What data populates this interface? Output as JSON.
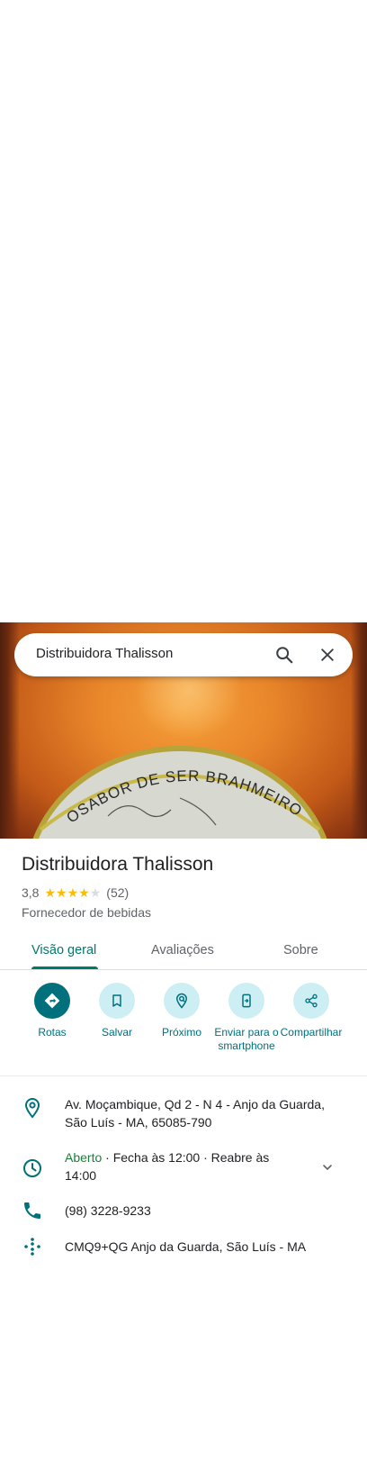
{
  "search": {
    "query": "Distribuidora Thalisson"
  },
  "hero": {
    "label_text": "OSABOR DE SER BRAHMEIRO"
  },
  "place": {
    "name": "Distribuidora Thalisson",
    "rating": "3,8",
    "rating_value": 3.8,
    "review_count": "(52)",
    "category": "Fornecedor de bebidas"
  },
  "tabs": [
    {
      "label": "Visão geral",
      "active": true
    },
    {
      "label": "Avaliações",
      "active": false
    },
    {
      "label": "Sobre",
      "active": false
    }
  ],
  "actions": [
    {
      "label": "Rotas",
      "icon": "directions-icon"
    },
    {
      "label": "Salvar",
      "icon": "bookmark-icon"
    },
    {
      "label": "Próximo",
      "icon": "nearby-icon"
    },
    {
      "label": "Enviar para o smartphone",
      "icon": "send-to-phone-icon"
    },
    {
      "label": "Compartilhar",
      "icon": "share-icon"
    }
  ],
  "info": {
    "address": "Av. Moçambique, Qd 2 - N 4 - Anjo da Guarda, São Luís - MA, 65085-790",
    "hours_status": "Aberto",
    "hours_detail": " · Fecha às 12:00 · Reabre às 14:00",
    "phone": "(98) 3228-9233",
    "plus_code": "CMQ9+QG Anjo da Guarda, São Luís - MA"
  },
  "colors": {
    "accent": "#00796b",
    "open": "#188038",
    "star": "#fbbc04"
  }
}
